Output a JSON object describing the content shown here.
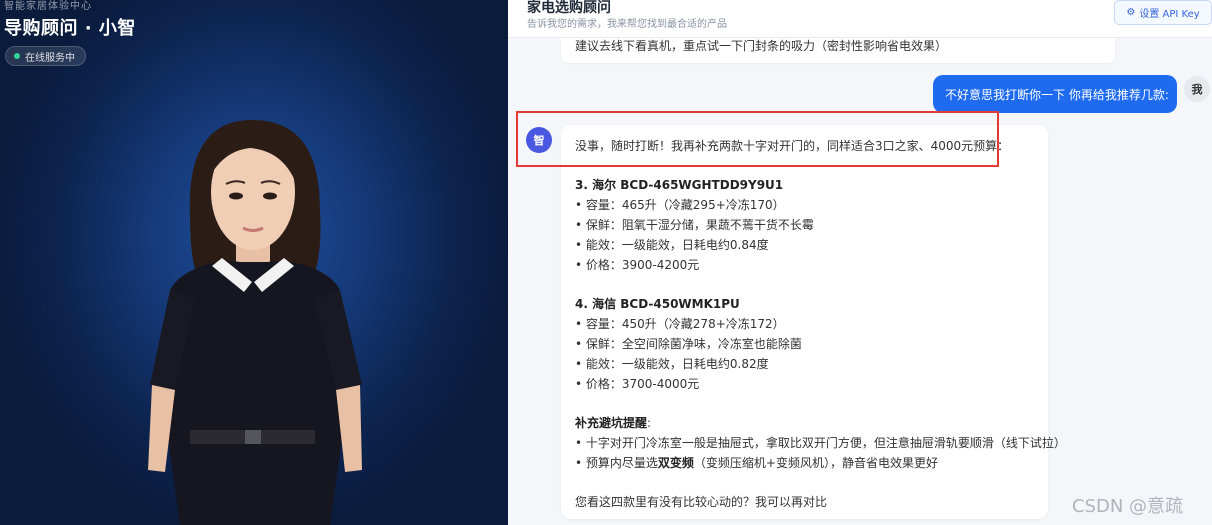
{
  "left_panel": {
    "kicker": "智能家居体验中心",
    "title": "导购顾问 · 小智",
    "status": "在线服务中"
  },
  "chat": {
    "title": "家电选购顾问",
    "subtitle": "告诉我您的需求，我来帮您找到最合适的产品",
    "api_button": "设置 API Key",
    "api_icon": "gear-icon",
    "prev_message_text": "建议去线下看真机，重点试一下门封条的吸力（密封性影响省电效果）",
    "user_message": "不好意思我打断你一下 你再给我推荐几款:",
    "user_avatar": "我",
    "bot_avatar": "智",
    "bot_intro": "没事，随时打断！我再补充两款十字对开门的，同样适合3口之家、4000元预算：",
    "products": [
      {
        "title": "3. 海尔 BCD-465WGHTDD9Y9U1",
        "bullets": [
          "• 容量：465升（冷藏295+冷冻170）",
          "• 保鲜：阻氧干湿分储，果蔬不蔫干货不长霉",
          "• 能效：一级能效，日耗电约0.84度",
          "• 价格：3900-4200元"
        ]
      },
      {
        "title": "4. 海信 BCD-450WMK1PU",
        "bullets": [
          "• 容量：450升（冷藏278+冷冻172）",
          "• 保鲜：全空间除菌净味，冷冻室也能除菌",
          "• 能效：一级能效，日耗电约0.82度",
          "• 价格：3700-4000元"
        ]
      }
    ],
    "tips_title": "补充避坑提醒",
    "tips_colon": ":",
    "tip1": "• 十字对开门冷冻室一般是抽屉式，拿取比双开门方便，但注意抽屉滑轨要顺滑（线下试拉）",
    "tip2_prefix": "• 预算内尽量选",
    "tip2_bold": "双变频",
    "tip2_suffix": "（变频压缩机+变频风机），静音省电效果更好",
    "closing": "您看这四款里有没有比较心动的？我可以再对比"
  },
  "watermark": "CSDN @意疏",
  "colors": {
    "accent_blue": "#1f6bf0",
    "bot_avatar": "#4a57e0",
    "highlight_red": "#e53935",
    "status_green": "#34d399"
  }
}
